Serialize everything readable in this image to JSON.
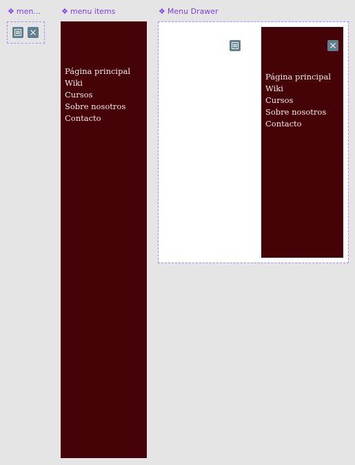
{
  "labels": {
    "menu_buttons": "men...",
    "menu_items": "menu items",
    "menu_drawer": "Menu Drawer"
  },
  "icons": {
    "hamburger": "hamburger-icon",
    "close": "close-icon",
    "component": "component-diamond-icon"
  },
  "colors": {
    "accent": "#7b3fe4",
    "drawer_bg": "#450308",
    "drawer_text": "#f3e9e9",
    "icon_bg": "#5f7f8f",
    "canvas_bg": "#e5e5e5"
  },
  "menu_items": [
    "Página principal",
    "Wiki",
    "Cursos",
    "Sobre nosotros",
    "Contacto"
  ]
}
